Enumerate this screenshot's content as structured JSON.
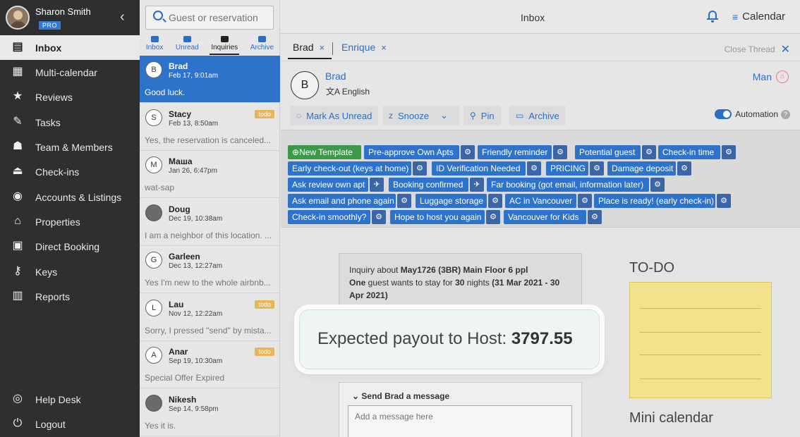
{
  "user": {
    "name": "Sharon Smith",
    "badge": "PRO"
  },
  "nav": [
    {
      "label": "Inbox",
      "icon": "inbox-icon",
      "glyph": "▤",
      "active": true
    },
    {
      "label": "Multi-calendar",
      "icon": "calendar-grid-icon",
      "glyph": "▦"
    },
    {
      "label": "Reviews",
      "icon": "star-icon",
      "glyph": "★"
    },
    {
      "label": "Tasks",
      "icon": "tasks-icon",
      "glyph": "✎"
    },
    {
      "label": "Team & Members",
      "icon": "team-icon",
      "glyph": "☗"
    },
    {
      "label": "Check-ins",
      "icon": "bell-desk-icon",
      "glyph": "⏏"
    },
    {
      "label": "Accounts & Listings",
      "icon": "account-icon",
      "glyph": "◉"
    },
    {
      "label": "Properties",
      "icon": "home-icon",
      "glyph": "⌂"
    },
    {
      "label": "Direct Booking",
      "icon": "booking-icon",
      "glyph": "▣"
    },
    {
      "label": "Keys",
      "icon": "key-icon",
      "glyph": "⚷"
    },
    {
      "label": "Reports",
      "icon": "reports-icon",
      "glyph": "▥"
    }
  ],
  "nav_bottom": [
    {
      "label": "Help Desk",
      "icon": "lifebuoy-icon",
      "glyph": "◎"
    },
    {
      "label": "Logout",
      "icon": "power-icon",
      "glyph": "⏻"
    }
  ],
  "search": {
    "placeholder": "Guest or reservation"
  },
  "filters": [
    {
      "label": "Inbox"
    },
    {
      "label": "Unread"
    },
    {
      "label": "Inquiries",
      "selected": true
    },
    {
      "label": "Archive"
    }
  ],
  "conversations": [
    {
      "name": "Brad",
      "initial": "B",
      "date": "Feb 17, 9:01am",
      "preview": "Good luck.",
      "active": true
    },
    {
      "name": "Stacy",
      "initial": "S",
      "date": "Feb 13, 8:50am",
      "preview": "Yes, the reservation is canceled...",
      "todo": "todo"
    },
    {
      "name": "Маша",
      "initial": "M",
      "date": "Jan 26, 6:47pm",
      "preview": "wat-sap"
    },
    {
      "name": "Doug",
      "initial": "",
      "photo": true,
      "date": "Dec 19, 10:38am",
      "preview": "I am a neighbor of this location. ..."
    },
    {
      "name": "Garleen",
      "initial": "G",
      "date": "Dec 13, 12:27am",
      "preview": "Yes I'm new to the whole airbnb..."
    },
    {
      "name": "Lau",
      "initial": "L",
      "date": "Nov 12, 12:22am",
      "preview": "Sorry, I pressed \"send\" by mista...",
      "todo": "todo"
    },
    {
      "name": "Anar",
      "initial": "A",
      "date": "Sep 19, 10:30am",
      "preview": "Special Offer Expired",
      "todo": "todo"
    },
    {
      "name": "Nikesh",
      "initial": "",
      "photo": true,
      "date": "Sep 14, 9:58pm",
      "preview": "Yes it is."
    }
  ],
  "topbar": {
    "title": "Inbox",
    "calendar_label": "Calendar"
  },
  "tabs": [
    {
      "label": "Brad"
    },
    {
      "label": "Enrique"
    }
  ],
  "close_thread": "Close Thread",
  "guest": {
    "name": "Brad",
    "initial": "B",
    "language": "English",
    "assignee": "Man"
  },
  "actions": {
    "mark_unread": "Mark As Unread",
    "snooze": "Snooze",
    "pin": "Pin",
    "archive": "Archive",
    "automation": "Automation"
  },
  "templates": {
    "new": "New Template",
    "items": [
      "Pre-approve Own Apts",
      "Friendly reminder",
      "Potential guest",
      "Check-in time",
      "Early check-out (keys at home)",
      "ID Verification Needed",
      "PRICING",
      "Damage deposit",
      "Ask review own apt",
      "Booking confirmed",
      "Far booking (got email, information later)",
      "Ask email and phone again",
      "Luggage storage",
      "AC in Vancouver",
      "Place is ready! (early check-in)",
      "Check-in smoothly?",
      "Hope to host you again",
      "Vancouver for Kids"
    ]
  },
  "inquiry": {
    "prefix": "Inquiry about ",
    "listing": "May1726 (3BR) Main Floor 6 ppl",
    "guests": "One",
    "mid": " guest wants to stay for ",
    "nights": "30",
    "nights_suffix": " nights ",
    "dates": "(31 Mar 2021 - 30 Apr 2021)"
  },
  "payout": {
    "label": "Expected payout to Host: ",
    "amount": "3797.55"
  },
  "todo_title": "TO-DO",
  "mini_calendar_title": "Mini calendar",
  "composer": {
    "label": "Send Brad a message",
    "placeholder": "Add a message here"
  },
  "colors": {
    "accent": "#2e73cb",
    "sidebar": "#2f2f2f",
    "todo_badge": "#e9b55a",
    "sticky": "#f1e38b"
  }
}
